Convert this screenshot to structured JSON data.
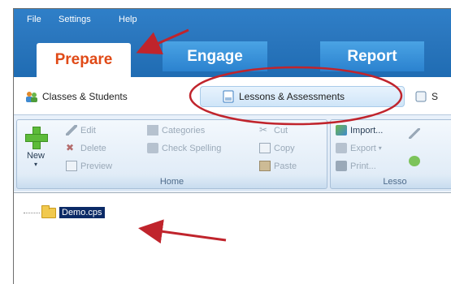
{
  "menu": {
    "file": "File",
    "settings": "Settings",
    "help": "Help"
  },
  "tabs": {
    "prepare": "Prepare",
    "engage": "Engage",
    "report": "Report"
  },
  "subtabs": {
    "classes": "Classes & Students",
    "lessons": "Lessons & Assessments",
    "s": "S"
  },
  "ribbon": {
    "new": "New",
    "edit": "Edit",
    "delete": "Delete",
    "preview": "Preview",
    "categories": "Categories",
    "check_spelling": "Check Spelling",
    "cut": "Cut",
    "copy": "Copy",
    "paste": "Paste",
    "home_group": "Home",
    "import": "Import...",
    "export": "Export",
    "print": "Print...",
    "lesso_group": "Lesso"
  },
  "tree": {
    "item": "Demo.cps"
  },
  "colors": {
    "accent_orange": "#e04a17",
    "brand_blue": "#2a76bd",
    "annotation_red": "#c0242c"
  }
}
